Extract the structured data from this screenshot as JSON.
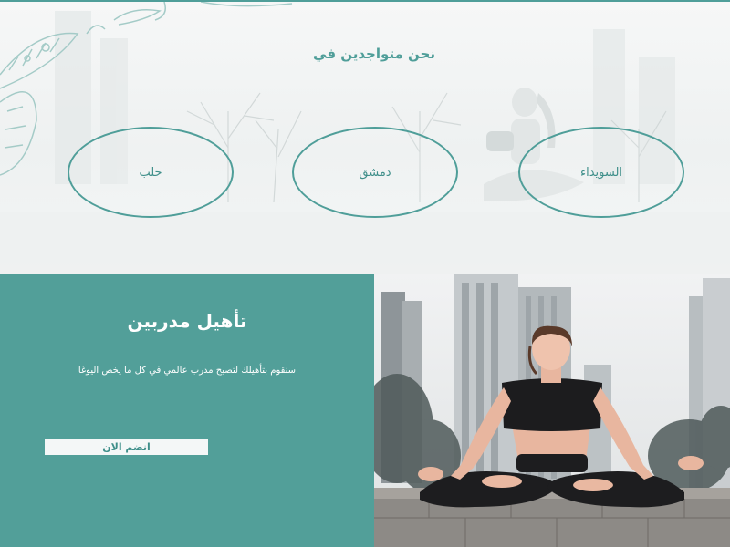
{
  "locations": {
    "title": "نحن متواجدين في",
    "cities": [
      {
        "label": "حلب"
      },
      {
        "label": "دمشق"
      },
      {
        "label": "السويداء"
      }
    ]
  },
  "trainers": {
    "title": "تأهيل مدربين",
    "description": "سنقوم بتأهيلك لتصبح مدرب عالمي في كل ما يخص اليوغا",
    "join_label": "انضم الان"
  },
  "colors": {
    "accent": "#529f99",
    "accent_dark": "#3f8f8a",
    "button_bg": "#f4f7f7"
  },
  "icons": {
    "decor": "leaf-ornament-icon"
  }
}
